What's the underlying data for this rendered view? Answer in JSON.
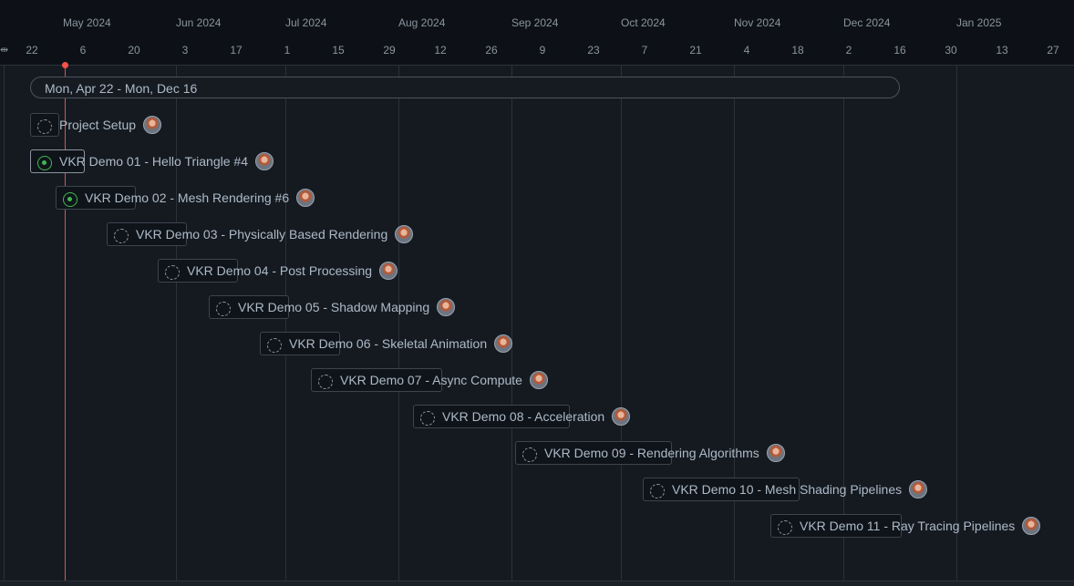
{
  "timeline": {
    "months": [
      "May 2024",
      "Jun 2024",
      "Jul 2024",
      "Aug 2024",
      "Sep 2024",
      "Oct 2024",
      "Nov 2024",
      "Dec 2024",
      "Jan 2025"
    ],
    "days": [
      "22",
      "6",
      "20",
      "3",
      "17",
      "1",
      "15",
      "29",
      "12",
      "26",
      "9",
      "23",
      "7",
      "21",
      "4",
      "18",
      "2",
      "16",
      "30",
      "13",
      "27"
    ]
  },
  "range": {
    "label": "Mon, Apr 22 - Mon, Dec 16"
  },
  "colors": {
    "today_marker": "#f85149",
    "in_progress": "#3fb950",
    "todo": "#8b949e"
  },
  "items": [
    {
      "title": "Project Setup",
      "status": "todo",
      "avatar_icon": "user-avatar-icon"
    },
    {
      "title": "VKR Demo 01 - Hello Triangle #4",
      "status": "in-progress",
      "avatar_icon": "user-avatar-icon"
    },
    {
      "title": "VKR Demo 02 - Mesh Rendering #6",
      "status": "in-progress",
      "avatar_icon": "user-avatar-icon"
    },
    {
      "title": "VKR Demo 03 - Physically Based Rendering",
      "status": "todo",
      "avatar_icon": "user-avatar-icon"
    },
    {
      "title": "VKR Demo 04 - Post Processing",
      "status": "todo",
      "avatar_icon": "user-avatar-icon"
    },
    {
      "title": "VKR Demo 05 - Shadow Mapping",
      "status": "todo",
      "avatar_icon": "user-avatar-icon"
    },
    {
      "title": "VKR Demo 06 - Skeletal Animation",
      "status": "todo",
      "avatar_icon": "user-avatar-icon"
    },
    {
      "title": "VKR Demo 07 - Async Compute",
      "status": "todo",
      "avatar_icon": "user-avatar-icon"
    },
    {
      "title": "VKR Demo 08 - Acceleration",
      "status": "todo",
      "avatar_icon": "user-avatar-icon"
    },
    {
      "title": "VKR Demo 09 - Rendering Algorithms",
      "status": "todo",
      "avatar_icon": "user-avatar-icon"
    },
    {
      "title": "VKR Demo 10 - Mesh Shading Pipelines",
      "status": "todo",
      "avatar_icon": "user-avatar-icon"
    },
    {
      "title": "VKR Demo 11 - Ray Tracing Pipelines",
      "status": "todo",
      "avatar_icon": "user-avatar-icon"
    }
  ]
}
